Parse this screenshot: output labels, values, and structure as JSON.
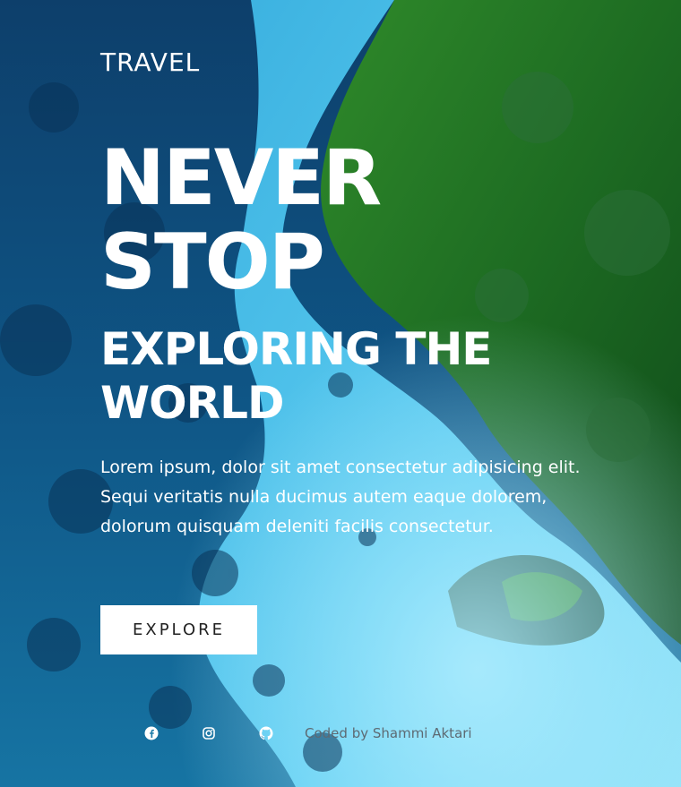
{
  "brand": "TRAVEL",
  "hero": {
    "headline": [
      "NEVER",
      "STOP"
    ],
    "subheadline": [
      "EXPLORING THE",
      "WORLD"
    ],
    "paragraph": "Lorem ipsum, dolor sit amet consectetur adipisicing elit. Sequi veritatis nulla ducimus autem eaque dolorem, dolorum quisquam deleniti facilis consectetur.",
    "button_label": "EXPLORE"
  },
  "footer": {
    "socials": [
      {
        "icon": "facebook-icon"
      },
      {
        "icon": "instagram-icon"
      },
      {
        "icon": "github-icon"
      }
    ],
    "credit": "Coded by Shammi Aktari"
  },
  "colors": {
    "ocean_dark": "#0b4a7a",
    "water_light": "#4fc3ee",
    "forest": "#1f7a22",
    "text": "#ffffff",
    "button_bg": "#ffffff",
    "button_text": "#222222",
    "credit_text": "#5d6a73"
  }
}
